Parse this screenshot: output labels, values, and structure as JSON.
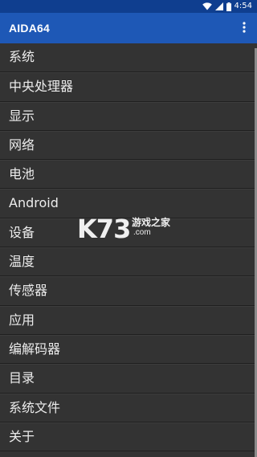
{
  "status_bar": {
    "time": "4:54",
    "icons": [
      "wifi-icon",
      "signal-icon",
      "battery-icon"
    ]
  },
  "app_bar": {
    "title": "AIDA64",
    "overflow_icon": "more-vert-icon"
  },
  "menu": {
    "items": [
      {
        "label": "系统"
      },
      {
        "label": "中央处理器"
      },
      {
        "label": "显示"
      },
      {
        "label": "网络"
      },
      {
        "label": "电池"
      },
      {
        "label": "Android"
      },
      {
        "label": "设备"
      },
      {
        "label": "温度"
      },
      {
        "label": "传感器"
      },
      {
        "label": "应用"
      },
      {
        "label": "编解码器"
      },
      {
        "label": "目录"
      },
      {
        "label": "系统文件"
      },
      {
        "label": "关于"
      }
    ]
  },
  "watermark": {
    "logo": "K73",
    "name": "游戏之家",
    "url": ".com"
  },
  "colors": {
    "status_bar": "#0f3e8f",
    "app_bar": "#1e58b6",
    "list_background": "#333333",
    "list_text": "#ececec"
  }
}
